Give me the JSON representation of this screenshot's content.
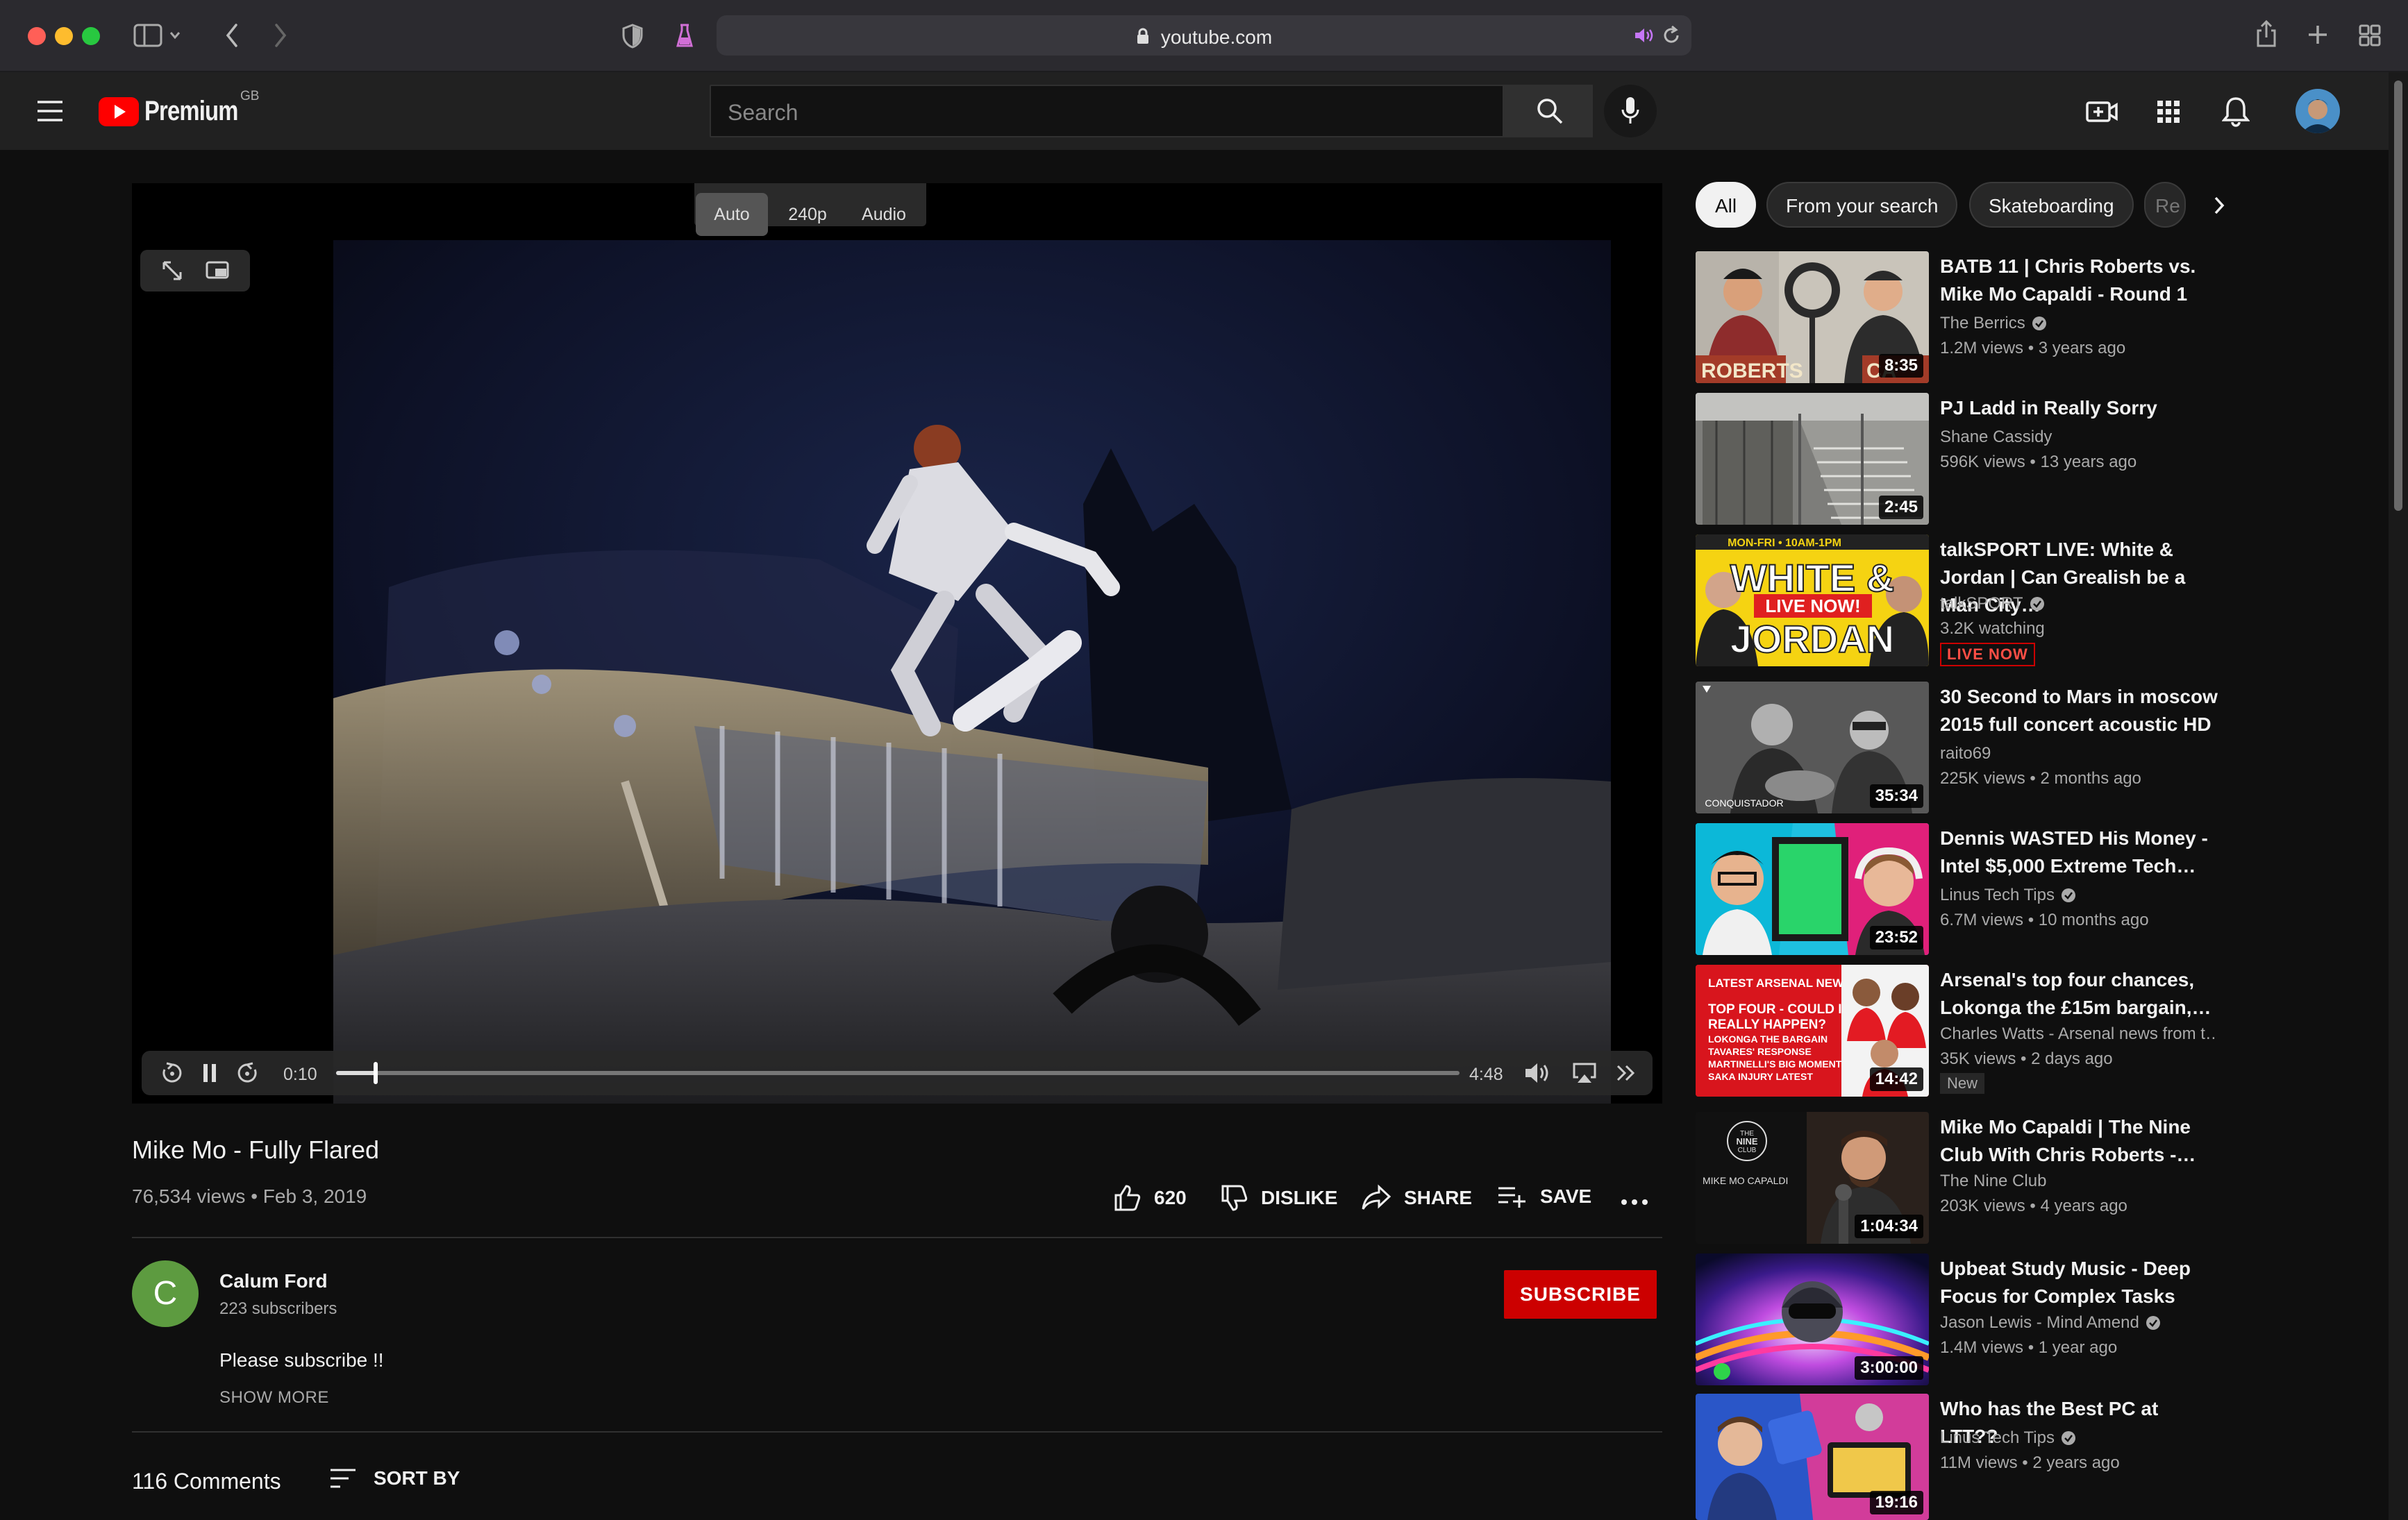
{
  "browser": {
    "url": "youtube.com"
  },
  "header": {
    "logo_text": "Premium",
    "region": "GB",
    "search_placeholder": "Search"
  },
  "player": {
    "quality_options": [
      "Auto",
      "240p",
      "Audio"
    ],
    "quality_selected": "Auto",
    "current_time": "0:10",
    "duration": "4:48",
    "progress_fraction": 0.035
  },
  "video": {
    "title": "Mike Mo - Fully Flared",
    "meta": "76,534 views • Feb 3, 2019",
    "like_count": "620",
    "dislike_label": "DISLIKE",
    "share_label": "SHARE",
    "save_label": "SAVE"
  },
  "channel": {
    "avatar_letter": "C",
    "name": "Calum Ford",
    "subscribers": "223 subscribers",
    "subscribe_label": "SUBSCRIBE",
    "description": "Please subscribe !!",
    "show_more": "SHOW MORE"
  },
  "comments": {
    "count_label": "116 Comments",
    "sort_label": "SORT BY"
  },
  "chips": [
    "All",
    "From your search",
    "Skateboarding",
    "Re"
  ],
  "recommendations": [
    {
      "title": "BATB 11 | Chris Roberts vs. Mike Mo Capaldi - Round 1",
      "channel": "The Berrics",
      "verified": true,
      "stats": "1.2M views • 3 years ago",
      "duration": "8:35"
    },
    {
      "title": "PJ Ladd in Really Sorry",
      "channel": "Shane Cassidy",
      "verified": false,
      "stats": "596K views • 13 years ago",
      "duration": "2:45"
    },
    {
      "title": "talkSPORT LIVE: White & Jordan | Can Grealish be a Man City…",
      "channel": "talkSPORT",
      "verified": true,
      "stats": "3.2K watching",
      "badge": "LIVE NOW",
      "duration": ""
    },
    {
      "title": "30 Second to Mars in moscow 2015 full concert acoustic HD",
      "channel": "raito69",
      "verified": false,
      "stats": "225K views • 2 months ago",
      "duration": "35:34"
    },
    {
      "title": "Dennis WASTED His Money - Intel $5,000 Extreme Tech…",
      "channel": "Linus Tech Tips",
      "verified": true,
      "stats": "6.7M views • 10 months ago",
      "duration": "23:52"
    },
    {
      "title": "Arsenal's top four chances, Lokonga the £15m bargain,…",
      "channel": "Charles Watts - Arsenal news from t…",
      "verified": false,
      "stats": "35K views • 2 days ago",
      "badge": "New",
      "duration": "14:42"
    },
    {
      "title": "Mike Mo Capaldi | The Nine Club With Chris Roberts -…",
      "channel": "The Nine Club",
      "verified": false,
      "stats": "203K views • 4 years ago",
      "duration": "1:04:34"
    },
    {
      "title": "Upbeat Study Music - Deep Focus for Complex Tasks",
      "channel": "Jason Lewis - Mind Amend",
      "verified": true,
      "stats": "1.4M views • 1 year ago",
      "duration": "3:00:00"
    },
    {
      "title": "Who has the Best PC at LTT??",
      "channel": "Linus Tech Tips",
      "verified": true,
      "stats": "11M views • 2 years ago",
      "duration": "19:16"
    }
  ],
  "thumb_text": {
    "batb_left": "ROBERTS",
    "batb_right": "CA",
    "talksport_top": "MON-FRI • 10AM-1PM",
    "talksport_main": "WHITE &",
    "talksport_live": "LIVE NOW!",
    "talksport_bottom": "JORDAN",
    "concert_caption": "CONQUISTADOR",
    "arsenal_header": "LATEST ARSENAL NEWS",
    "arsenal_lines": [
      "TOP FOUR - COULD IT",
      "REALLY HAPPEN?",
      "LOKONGA THE BARGAIN",
      "TAVARES' RESPONSE",
      "MARTINELLI'S BIG MOMENT",
      "SAKA INJURY LATEST"
    ],
    "nineclub_logo_lines": [
      "THE",
      "NINE",
      "CLUB"
    ],
    "nineclub_name": "MIKE MO CAPALDI"
  },
  "colors": {
    "background": "#0f0f0f",
    "youtube_red": "#ff0000",
    "subscribe_red": "#cc0000",
    "channel_avatar": "#5d9b40"
  }
}
